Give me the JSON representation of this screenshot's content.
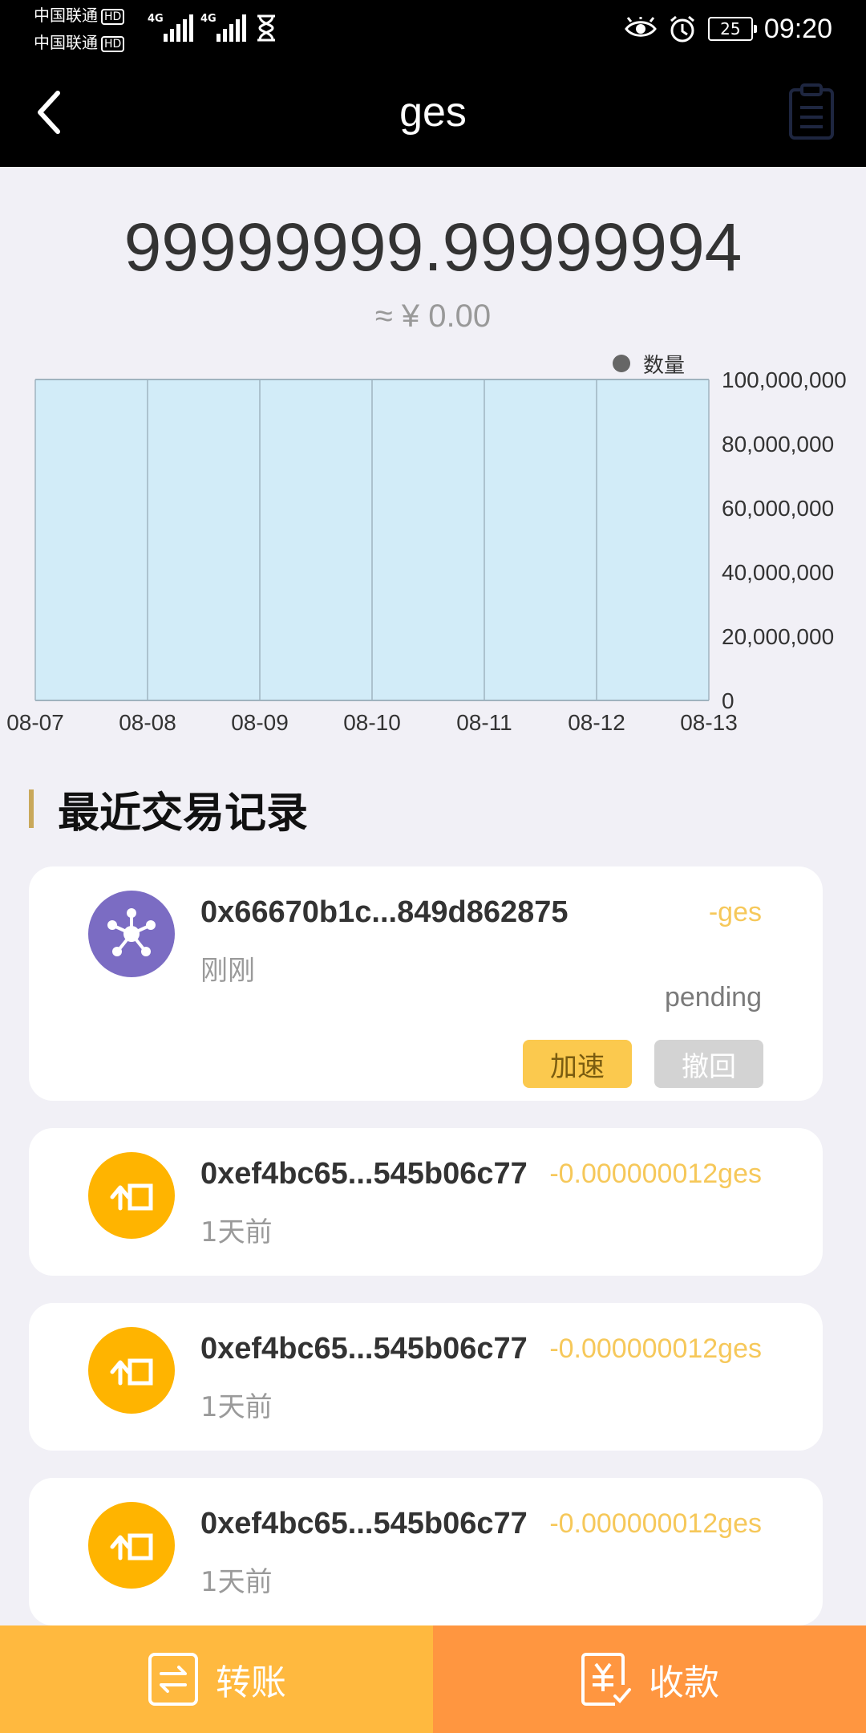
{
  "status_bar": {
    "carrier1": "中国联通",
    "carrier2": "中国联通",
    "hd": "HD",
    "net1": "4G",
    "net2": "4G",
    "battery": "25",
    "time": "09:20"
  },
  "nav": {
    "title": "ges",
    "back_icon": "chevron-left-icon",
    "clipboard_icon": "clipboard-icon"
  },
  "balance": {
    "amount": "99999999.99999994",
    "fiat": "≈ ¥ 0.00"
  },
  "chart_data": {
    "type": "area",
    "legend": [
      "数量"
    ],
    "legend_placement": "top-right",
    "categories": [
      "08-07",
      "08-08",
      "08-09",
      "08-10",
      "08-11",
      "08-12",
      "08-13"
    ],
    "series": [
      {
        "name": "数量",
        "values": [
          99999999.99999994,
          99999999.99999994,
          99999999.99999994,
          99999999.99999994,
          99999999.99999994,
          99999999.99999994,
          99999999.99999994
        ]
      }
    ],
    "ylim": [
      0,
      100000000
    ],
    "yticks": [
      "0",
      "20,000,000",
      "40,000,000",
      "60,000,000",
      "80,000,000",
      "100,000,000"
    ],
    "grid": "vertical",
    "fill_color": "#d2ecf8",
    "line_color": "#9fb3bf"
  },
  "section": {
    "title": "最近交易记录"
  },
  "transactions": [
    {
      "address": "0x66670b1c...849d862875",
      "amount": "-ges",
      "time": "刚刚",
      "status": "pending",
      "speed_label": "加速",
      "cancel_label": "撤回",
      "icon": "network-nodes-icon"
    },
    {
      "address": "0xef4bc65...545b06c77",
      "amount": "-0.000000012ges",
      "time": "1天前",
      "icon": "send-out-icon"
    },
    {
      "address": "0xef4bc65...545b06c77",
      "amount": "-0.000000012ges",
      "time": "1天前",
      "icon": "send-out-icon"
    },
    {
      "address": "0xef4bc65...545b06c77",
      "amount": "-0.000000012ges",
      "time": "1天前",
      "icon": "send-out-icon"
    }
  ],
  "bottom": {
    "transfer_label": "转账",
    "receive_label": "收款"
  },
  "colors": {
    "accent_yellow": "#ffb93f",
    "accent_orange": "#ff9640",
    "avatar_purple": "#7b6cc3",
    "avatar_gold": "#ffb400",
    "amount_color": "#f6c85a"
  }
}
